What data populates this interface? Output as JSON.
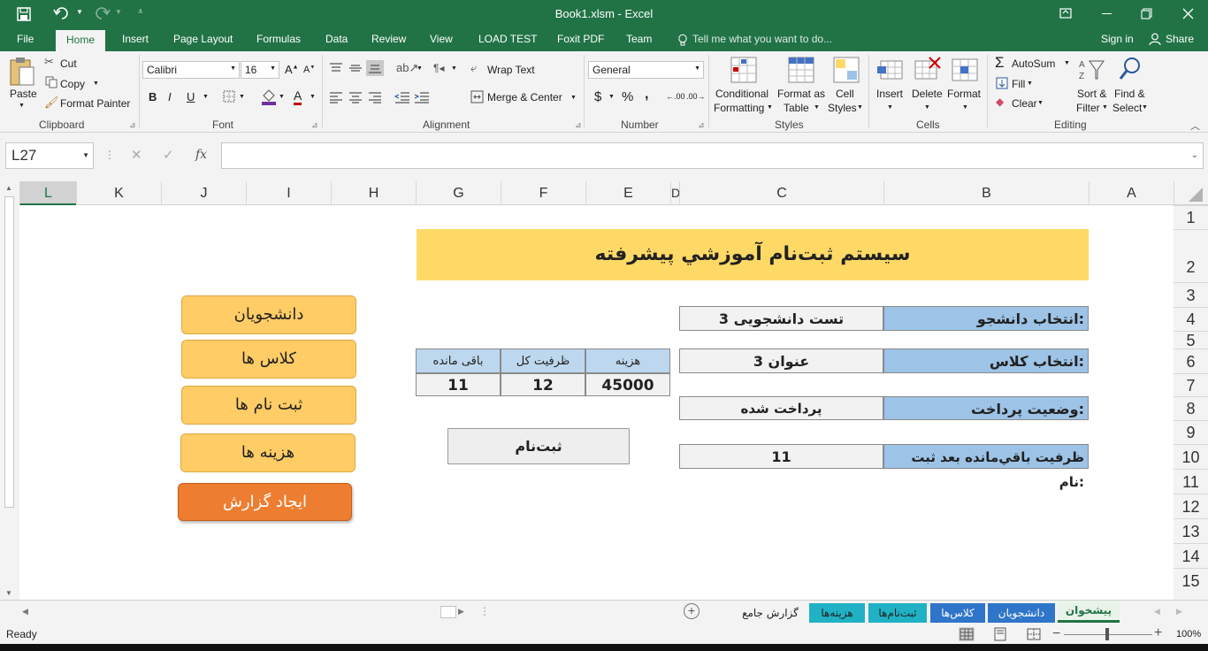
{
  "window": {
    "title": "Book1.xlsm - Excel",
    "undo_icon": "undo-icon",
    "redo_icon": "redo-icon"
  },
  "menu": {
    "tabs": [
      "File",
      "Home",
      "Insert",
      "Page Layout",
      "Formulas",
      "Data",
      "Review",
      "View",
      "LOAD TEST",
      "Foxit PDF",
      "Team"
    ],
    "active_tab": "Home",
    "tell_me": "Tell me what you want to do...",
    "sign_in": "Sign in",
    "share": "Share"
  },
  "ribbon": {
    "clipboard": {
      "paste": "Paste",
      "cut": "Cut",
      "copy": "Copy",
      "format_painter": "Format Painter",
      "group": "Clipboard"
    },
    "font": {
      "name": "Calibri",
      "size": "16",
      "bold": "B",
      "italic": "I",
      "underline": "U",
      "group": "Font"
    },
    "alignment": {
      "wrap_text": "Wrap Text",
      "merge_center": "Merge & Center",
      "group": "Alignment"
    },
    "number": {
      "format": "General",
      "currency": "$",
      "percent": "%",
      "comma": ",",
      "group": "Number"
    },
    "styles": {
      "conditional_1": "Conditional",
      "conditional_2": "Formatting",
      "format_table_1": "Format as",
      "format_table_2": "Table",
      "cell_styles_1": "Cell",
      "cell_styles_2": "Styles",
      "group": "Styles"
    },
    "cells": {
      "insert": "Insert",
      "delete": "Delete",
      "format": "Format",
      "group": "Cells"
    },
    "editing": {
      "autosum": "AutoSum",
      "fill": "Fill",
      "clear": "Clear",
      "sort_1": "Sort &",
      "sort_2": "Filter",
      "find_1": "Find &",
      "find_2": "Select",
      "group": "Editing"
    }
  },
  "formula_bar": {
    "name_box": "L27",
    "fx": "fx",
    "value": ""
  },
  "columns": [
    "L",
    "K",
    "J",
    "I",
    "H",
    "G",
    "F",
    "E",
    "D",
    "C",
    "B",
    "A"
  ],
  "rows": [
    "1",
    "2",
    "3",
    "4",
    "5",
    "6",
    "7",
    "8",
    "9",
    "10",
    "11",
    "12",
    "13",
    "14",
    "15"
  ],
  "sheet": {
    "title": "سيستم ثبت‌نام آموزشي پيشرفته",
    "labels": {
      "student": "انتخاب دانشجو:",
      "class": "انتخاب کلاس:",
      "payment": "وضعیت پرداخت:",
      "remaining_after": "ظرفيت باقي‌مانده بعد ثبت نام:"
    },
    "values": {
      "student": "تست دانشجویی 3",
      "class": "عنوان 3",
      "payment": "پرداخت شده",
      "remaining_after": "11"
    },
    "mini_table": {
      "headers": [
        "هزینه",
        "ظرفیت کل",
        "باقی مانده"
      ],
      "row": [
        "45000",
        "12",
        "11"
      ]
    },
    "register_button": "ثبت‌نام",
    "nav_buttons": [
      "دانشجویان",
      "کلاس ها",
      "ثبت نام ها",
      "هزینه ها"
    ],
    "report_button": "ایجاد گزارش"
  },
  "sheet_tabs": [
    {
      "label": "پیشخوان",
      "color": "#e8f4ea",
      "active": true
    },
    {
      "label": "دانشجویان",
      "color": "#2f75c9"
    },
    {
      "label": "کلاس‌ها",
      "color": "#2f75c9"
    },
    {
      "label": "ثبت‌نام‌ها",
      "color": "#20b2c4"
    },
    {
      "label": "هزینه‌ها",
      "color": "#20b2c4"
    },
    {
      "label": "گزارش جامع",
      "color": "#f3f3f3"
    }
  ],
  "status": {
    "ready": "Ready",
    "zoom": "100%"
  },
  "colors": {
    "excel_green": "#217346",
    "title_fill": "#ffd966",
    "label_fill": "#9dc3e6",
    "nav_fill": "#ffcc66",
    "report_fill": "#ed7d31"
  }
}
